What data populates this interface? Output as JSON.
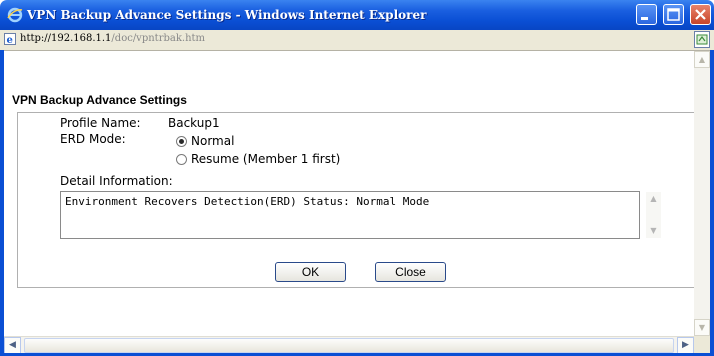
{
  "window": {
    "title": "VPN Backup Advance Settings - Windows Internet Explorer",
    "address_host": "http://192.168.1.1",
    "address_path": "/doc/vpntrbak.htm"
  },
  "page": {
    "heading": "VPN Backup Advance Settings",
    "profile_label": "Profile Name:",
    "profile_value": "Backup1",
    "erd_label": "ERD Mode:",
    "erd_options": [
      {
        "label": "Normal",
        "selected": true
      },
      {
        "label": "Resume (Member 1 first)",
        "selected": false
      }
    ],
    "detail_label": "Detail Information:",
    "detail_text": "Environment Recovers Detection(ERD) Status: Normal Mode",
    "ok_label": "OK",
    "close_label": "Close"
  },
  "colors": {
    "titlebar": "#0a4fd4",
    "close_button": "#c7452a"
  }
}
